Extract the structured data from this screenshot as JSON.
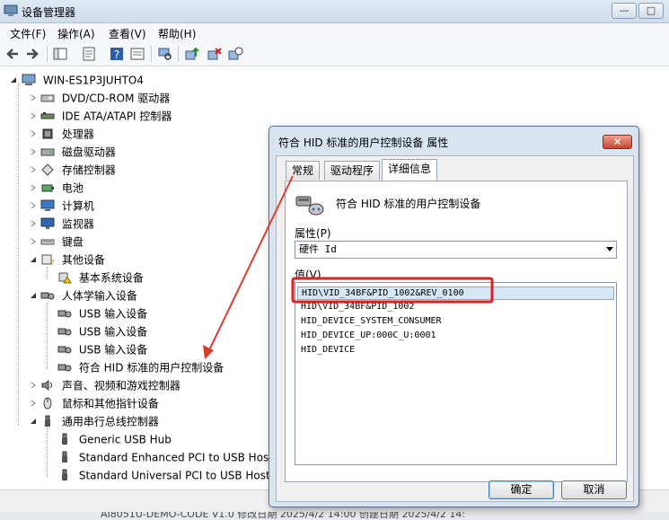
{
  "window": {
    "title": "设备管理器"
  },
  "titlebar": {
    "minimize": "—",
    "maximize": "□",
    "close": "✕"
  },
  "menu": [
    "文件(F)",
    "操作(A)",
    "查看(V)",
    "帮助(H)"
  ],
  "toolbar": {
    "icons": [
      "back-icon",
      "forward-icon",
      "console-tree-icon",
      "properties-icon",
      "help-icon",
      "view-icon",
      "scan-hardware-icon",
      "update-driver-icon",
      "uninstall-icon",
      "disable-icon"
    ]
  },
  "tree": {
    "root": "WIN-ES1P3JUHTO4",
    "categories": [
      {
        "label": "DVD/CD-ROM 驱动器",
        "icon": "dvd-drive-icon",
        "expanded": false
      },
      {
        "label": "IDE ATA/ATAPI 控制器",
        "icon": "ide-controller-icon",
        "expanded": false
      },
      {
        "label": "处理器",
        "icon": "processor-icon",
        "expanded": false
      },
      {
        "label": "磁盘驱动器",
        "icon": "disk-drive-icon",
        "expanded": false
      },
      {
        "label": "存储控制器",
        "icon": "storage-controller-icon",
        "expanded": false
      },
      {
        "label": "电池",
        "icon": "battery-icon",
        "expanded": false
      },
      {
        "label": "计算机",
        "icon": "computer-icon",
        "expanded": false
      },
      {
        "label": "监视器",
        "icon": "monitor-icon",
        "expanded": false
      },
      {
        "label": "键盘",
        "icon": "keyboard-icon",
        "expanded": false
      },
      {
        "label": "其他设备",
        "icon": "other-devices-icon",
        "expanded": true,
        "children": [
          "基本系统设备"
        ]
      },
      {
        "label": "人体学输入设备",
        "icon": "hid-icon",
        "expanded": true,
        "children": [
          "USB 输入设备",
          "USB 输入设备",
          "USB 输入设备",
          "符合 HID 标准的用户控制设备"
        ]
      },
      {
        "label": "声音、视频和游戏控制器",
        "icon": "sound-icon",
        "expanded": false
      },
      {
        "label": "鼠标和其他指针设备",
        "icon": "mouse-icon",
        "expanded": false
      },
      {
        "label": "通用串行总线控制器",
        "icon": "usb-controller-icon",
        "expanded": true,
        "children": [
          "Generic USB Hub",
          "Standard Enhanced PCI to USB Host",
          "Standard Universal PCI to USB Host"
        ]
      }
    ]
  },
  "dialog": {
    "title": "符合 HID 标准的用户控制设备 属性",
    "close": "✕",
    "tabs": [
      "常规",
      "驱动程序",
      "详细信息"
    ],
    "active_tab": "详细信息",
    "device_name": "符合 HID 标准的用户控制设备",
    "property_label": "属性(P)",
    "property_value": "硬件 Id",
    "value_label": "值(V)",
    "values": [
      "HID\\VID_34BF&PID_1002&REV_0100",
      "HID\\VID_34BF&PID_1002",
      "HID_DEVICE_SYSTEM_CONSUMER",
      "HID_DEVICE_UP:000C_U:0001",
      "HID_DEVICE"
    ],
    "selected_value_index": 0,
    "ok": "确定",
    "cancel": "取消"
  },
  "annotations": {
    "highlight_color": "#e02020",
    "arrow_color": "#e03a2a"
  },
  "taskstrip": {
    "text": "AI8051U-DEMO-CODE V1.0   修改日期 2025/4/2 14:00   创建日期 2025/4/2 14:"
  }
}
